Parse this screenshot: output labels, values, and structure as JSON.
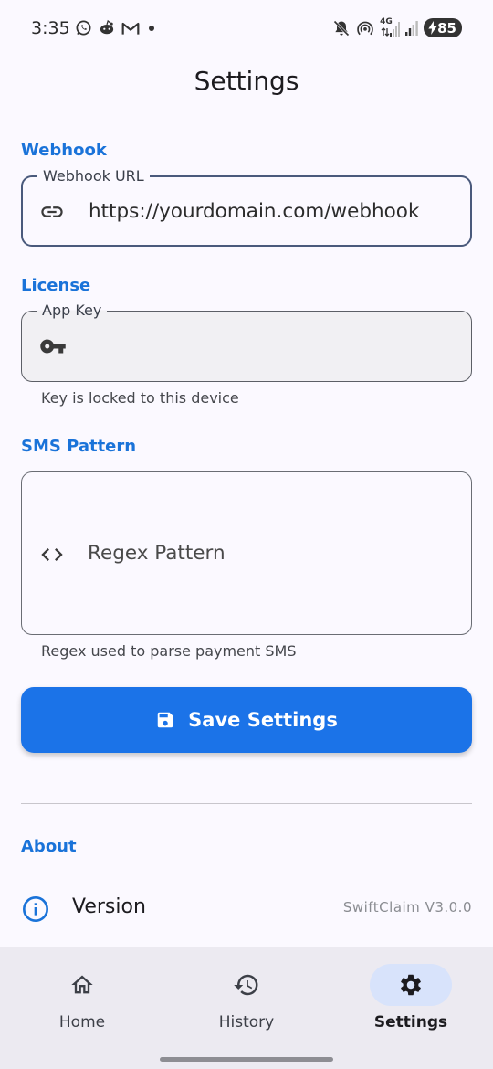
{
  "status_bar": {
    "time": "3:35",
    "left_icons": [
      "whatsapp-icon",
      "reddit-icon",
      "gmail-icon",
      "dot-icon"
    ],
    "right_icons": [
      "mute-icon",
      "hotspot-icon",
      "4g-signal-icon",
      "signal-icon",
      "signal-icon-2"
    ],
    "network_type": "4G",
    "battery_level": "85"
  },
  "page": {
    "title": "Settings"
  },
  "webhook": {
    "section_label": "Webhook",
    "field_label": "Webhook URL",
    "value": "https://yourdomain.com/webhook",
    "icon": "link-icon"
  },
  "license": {
    "section_label": "License",
    "field_label": "App Key",
    "value": "",
    "icon": "key-icon",
    "helper": "Key is locked to this device"
  },
  "sms_pattern": {
    "section_label": "SMS Pattern",
    "placeholder": "Regex Pattern",
    "icon": "code-icon",
    "helper": "Regex used to parse payment SMS"
  },
  "save_button": {
    "label": "Save Settings",
    "icon": "save-icon"
  },
  "about": {
    "section_label": "About",
    "version_label": "Version",
    "version_value": "SwiftClaim V3.0.0",
    "icon": "info-icon"
  },
  "bottom_nav": {
    "items": [
      {
        "label": "Home",
        "icon": "home-icon",
        "active": false
      },
      {
        "label": "History",
        "icon": "history-icon",
        "active": false
      },
      {
        "label": "Settings",
        "icon": "gear-icon",
        "active": true
      }
    ]
  },
  "colors": {
    "accent": "#1a73d9",
    "button": "#1b73e8",
    "background": "#fbf9ff",
    "nav_background": "#eceaf1",
    "active_pill": "#d8e3fb"
  }
}
